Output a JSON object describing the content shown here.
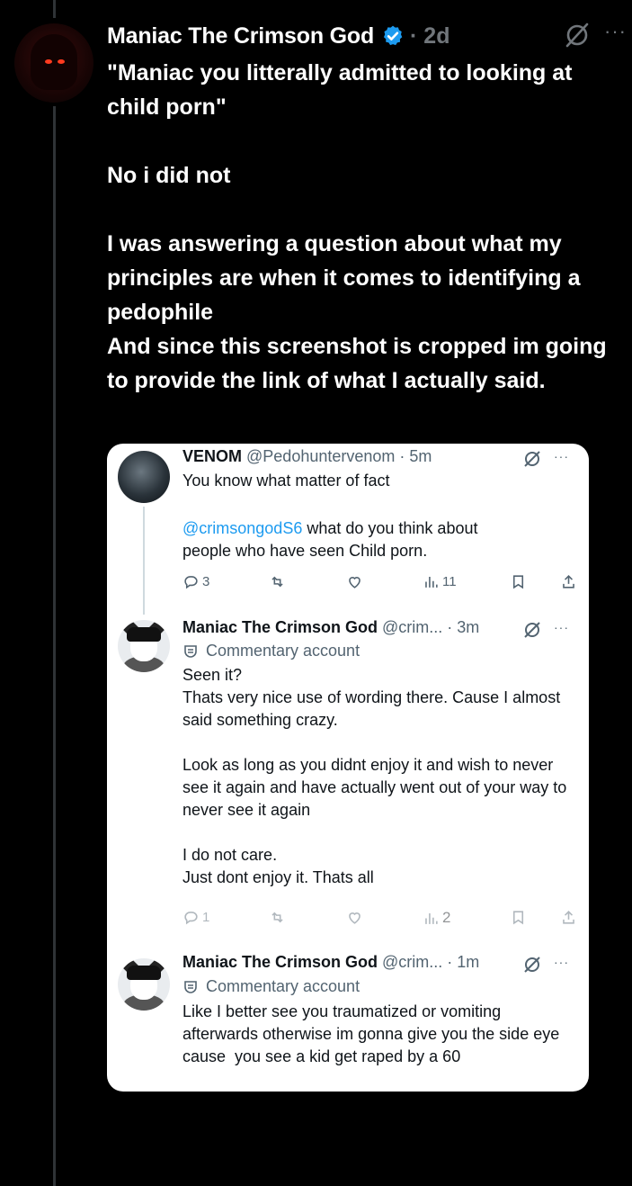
{
  "post": {
    "author": "Maniac The Crimson God",
    "time": "· 2d",
    "more": "···",
    "text": "\"Maniac you litterally admitted to looking at child porn\"\n\nNo i did not\n\nI was answering a question about what my principles are when it comes to identifying a pedophile\nAnd since this screenshot is cropped im going to provide the link of what I actually said."
  },
  "embed": {
    "tweet1": {
      "name": "VENOM",
      "handle": "@Pedohuntervenom · 5m",
      "more": "···",
      "line1": "You know what matter of fact",
      "mention": "@crimsongodS6",
      "line2": " what do you think about",
      "line3": "people who have seen Child porn.",
      "replies": "3",
      "views": "11"
    },
    "tweet2": {
      "name": "Maniac The Crimson God",
      "handle": "@crim... · 3m",
      "more": "···",
      "badge": "Commentary account",
      "text": "Seen it?\nThats very nice use of wording there. Cause I almost said something crazy.\n\nLook as long as you didnt enjoy it and wish to never see it again and have actually went out of your way to never see it again\n\nI do not care.\nJust dont enjoy it. Thats all",
      "replies": "1",
      "views": "2"
    },
    "tweet3": {
      "name": "Maniac The Crimson God",
      "handle": "@crim... · 1m",
      "more": "···",
      "badge": "Commentary account",
      "text": "Like I better see you traumatized or vomiting afterwards otherwise im gonna give you the side eye cause  you see a kid get raped by a 60"
    }
  },
  "icons": {
    "verified": "verified-badge-icon",
    "grok": "grok-icon",
    "reply": "reply-icon",
    "retweet": "retweet-icon",
    "like": "like-icon",
    "views": "views-icon",
    "bookmark": "bookmark-icon",
    "share": "share-icon"
  },
  "colors": {
    "background": "#000000",
    "verified": "#1d9bf0",
    "mention": "#1d9bf0",
    "muted": "#71767b"
  }
}
